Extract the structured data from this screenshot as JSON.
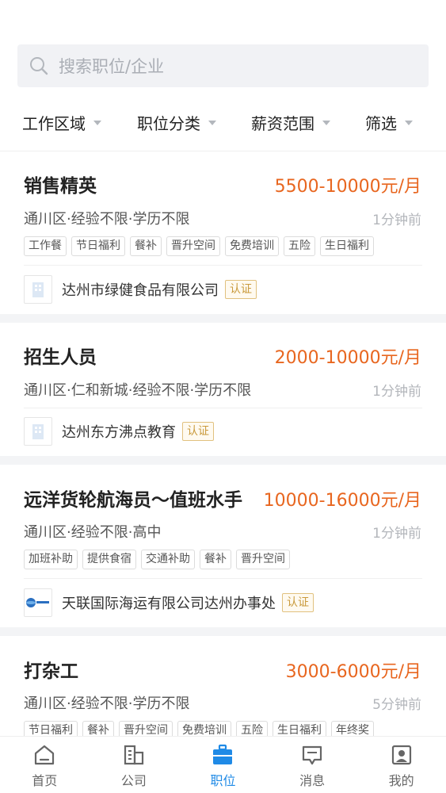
{
  "search": {
    "placeholder": "搜索职位/企业"
  },
  "filters": [
    "工作区域",
    "职位分类",
    "薪资范围",
    "筛选"
  ],
  "jobs": [
    {
      "title": "销售精英",
      "salary": "5500-10000元/月",
      "meta": "通川区·经验不限·学历不限",
      "time": "1分钟前",
      "tags": [
        "工作餐",
        "节日福利",
        "餐补",
        "晋升空间",
        "免费培训",
        "五险",
        "生日福利"
      ],
      "company": "达州市绿健食品有限公司",
      "cert": "认证"
    },
    {
      "title": "招生人员",
      "salary": "2000-10000元/月",
      "meta": "通川区·仁和新城·经验不限·学历不限",
      "time": "1分钟前",
      "tags": [],
      "company": "达州东方沸点教育",
      "cert": "认证"
    },
    {
      "title": "远洋货轮航海员～值班水手",
      "salary": "10000-16000元/月",
      "meta": "通川区·经验不限·高中",
      "time": "1分钟前",
      "tags": [
        "加班补助",
        "提供食宿",
        "交通补助",
        "餐补",
        "晋升空间"
      ],
      "company": "天联国际海运有限公司达州办事处",
      "cert": "认证"
    },
    {
      "title": "打杂工",
      "salary": "3000-6000元/月",
      "meta": "通川区·经验不限·学历不限",
      "time": "5分钟前",
      "tags": [
        "节日福利",
        "餐补",
        "晋升空间",
        "免费培训",
        "五险",
        "生日福利",
        "年终奖"
      ]
    }
  ],
  "tabbar": {
    "items": [
      {
        "label": "首页",
        "icon": "home-icon",
        "active": false
      },
      {
        "label": "公司",
        "icon": "building-icon",
        "active": false
      },
      {
        "label": "职位",
        "icon": "briefcase-icon",
        "active": true
      },
      {
        "label": "消息",
        "icon": "message-icon",
        "active": false
      },
      {
        "label": "我的",
        "icon": "profile-icon",
        "active": false
      }
    ]
  },
  "colors": {
    "accent": "#1f8ae6",
    "salary": "#e8661f",
    "cert": "#c99a3c"
  }
}
